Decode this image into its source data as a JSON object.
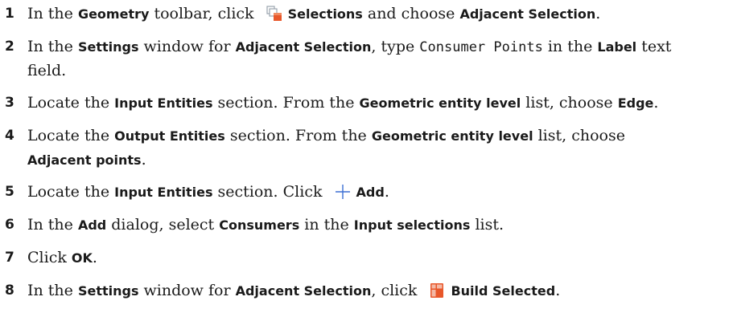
{
  "steps": [
    {
      "number": "1",
      "parts": {
        "t1": "In the ",
        "b1": "Geometry",
        "t2": " toolbar, click ",
        "icon": "selections-icon",
        "b2": "Selections",
        "t3": " and choose ",
        "b3": "Adjacent Selection",
        "t4": "."
      }
    },
    {
      "number": "2",
      "parts": {
        "t1": "In the ",
        "b1": "Settings",
        "t2": " window for ",
        "b2": "Adjacent Selection",
        "t3": ", type ",
        "m1": "Consumer Points",
        "t4": " in the ",
        "b3": "Label",
        "t5": " text",
        "t6": "field."
      }
    },
    {
      "number": "3",
      "parts": {
        "t1": "Locate the ",
        "b1": "Input Entities",
        "t2": " section. From the ",
        "b2": "Geometric entity level",
        "t3": " list, choose ",
        "b3": "Edge",
        "t4": "."
      }
    },
    {
      "number": "4",
      "parts": {
        "t1": "Locate the ",
        "b1": "Output Entities",
        "t2": " section. From the ",
        "b2": "Geometric entity level",
        "t3": " list, choose",
        "b3": "Adjacent points",
        "t4": "."
      }
    },
    {
      "number": "5",
      "parts": {
        "t1": "Locate the ",
        "b1": "Input Entities",
        "t2": " section. Click ",
        "icon": "plus-icon",
        "b2": "Add",
        "t3": "."
      }
    },
    {
      "number": "6",
      "parts": {
        "t1": "In the ",
        "b1": "Add",
        "t2": " dialog, select ",
        "b2": "Consumers",
        "t3": " in the ",
        "b3": "Input selections",
        "t4": " list."
      }
    },
    {
      "number": "7",
      "parts": {
        "t1": "Click ",
        "b1": "OK",
        "t2": "."
      }
    },
    {
      "number": "8",
      "parts": {
        "t1": "In the ",
        "b1": "Settings",
        "t2": " window for ",
        "b2": "Adjacent Selection",
        "t3": ", click ",
        "icon": "build-selected-icon",
        "b3": "Build Selected",
        "t4": "."
      }
    }
  ],
  "colors": {
    "text": "#1a1a1a",
    "plus_icon": "#3b6fd4",
    "build_icon_orange": "#e8572a",
    "build_icon_light": "#f3b8a5",
    "selections_icon_orange": "#e8572a",
    "selections_icon_gray": "#9aa3ad"
  }
}
